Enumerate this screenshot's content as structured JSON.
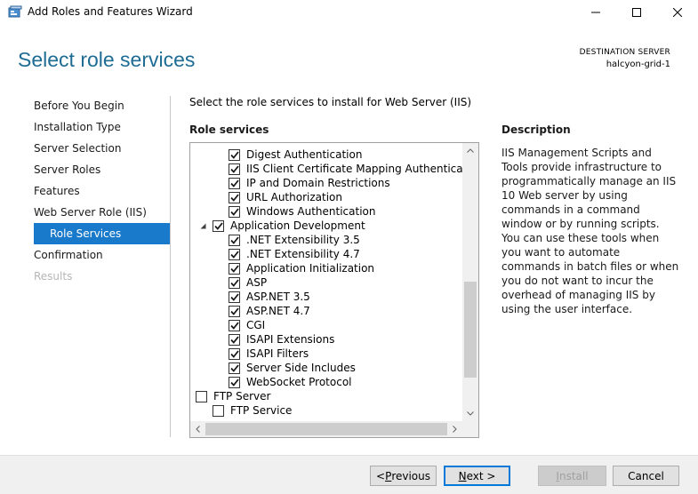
{
  "window": {
    "title": "Add Roles and Features Wizard"
  },
  "header": {
    "page_title": "Select role services",
    "destination_label": "DESTINATION SERVER",
    "destination_value": "halcyon-grid-1"
  },
  "nav": {
    "items": [
      {
        "label": "Before You Begin",
        "state": "normal"
      },
      {
        "label": "Installation Type",
        "state": "normal"
      },
      {
        "label": "Server Selection",
        "state": "normal"
      },
      {
        "label": "Server Roles",
        "state": "normal"
      },
      {
        "label": "Features",
        "state": "normal"
      },
      {
        "label": "Web Server Role (IIS)",
        "state": "normal"
      },
      {
        "label": "Role Services",
        "state": "selected"
      },
      {
        "label": "Confirmation",
        "state": "normal"
      },
      {
        "label": "Results",
        "state": "disabled"
      }
    ]
  },
  "main": {
    "instruction": "Select the role services to install for Web Server (IIS)",
    "role_services_heading": "Role services",
    "description_heading": "Description",
    "description_text": "IIS Management Scripts and Tools provide infrastructure to programmatically manage an IIS 10 Web server by using commands in a command window or by running scripts. You can use these tools when you want to automate commands in batch files or when you do not want to incur the overhead of managing IIS by using the user interface."
  },
  "tree": {
    "items": [
      {
        "label": "Digest Authentication",
        "checked": true,
        "level": 3,
        "expander": "none"
      },
      {
        "label": "IIS Client Certificate Mapping Authentication",
        "checked": true,
        "level": 3,
        "expander": "none"
      },
      {
        "label": "IP and Domain Restrictions",
        "checked": true,
        "level": 3,
        "expander": "none"
      },
      {
        "label": "URL Authorization",
        "checked": true,
        "level": 3,
        "expander": "none"
      },
      {
        "label": "Windows Authentication",
        "checked": true,
        "level": 3,
        "expander": "none"
      },
      {
        "label": "Application Development",
        "checked": true,
        "level": 2,
        "expander": "expanded"
      },
      {
        "label": ".NET Extensibility 3.5",
        "checked": true,
        "level": 3,
        "expander": "none"
      },
      {
        "label": ".NET Extensibility 4.7",
        "checked": true,
        "level": 3,
        "expander": "none"
      },
      {
        "label": "Application Initialization",
        "checked": true,
        "level": 3,
        "expander": "none"
      },
      {
        "label": "ASP",
        "checked": true,
        "level": 3,
        "expander": "none"
      },
      {
        "label": "ASP.NET 3.5",
        "checked": true,
        "level": 3,
        "expander": "none"
      },
      {
        "label": "ASP.NET 4.7",
        "checked": true,
        "level": 3,
        "expander": "none"
      },
      {
        "label": "CGI",
        "checked": true,
        "level": 3,
        "expander": "none"
      },
      {
        "label": "ISAPI Extensions",
        "checked": true,
        "level": 3,
        "expander": "none"
      },
      {
        "label": "ISAPI Filters",
        "checked": true,
        "level": 3,
        "expander": "none"
      },
      {
        "label": "Server Side Includes",
        "checked": true,
        "level": 3,
        "expander": "none"
      },
      {
        "label": "WebSocket Protocol",
        "checked": true,
        "level": 3,
        "expander": "none"
      },
      {
        "label": "FTP Server",
        "checked": false,
        "level": 1,
        "expander": "expanded"
      },
      {
        "label": "FTP Service",
        "checked": false,
        "level": 2,
        "expander": "none"
      }
    ]
  },
  "footer": {
    "previous_label": "< Previous",
    "next_label": "Next >",
    "install_label": "Install",
    "cancel_label": "Cancel"
  },
  "colors": {
    "title_blue": "#1e6c93",
    "selection_blue": "#1979ca",
    "default_button_border": "#0078d7"
  }
}
